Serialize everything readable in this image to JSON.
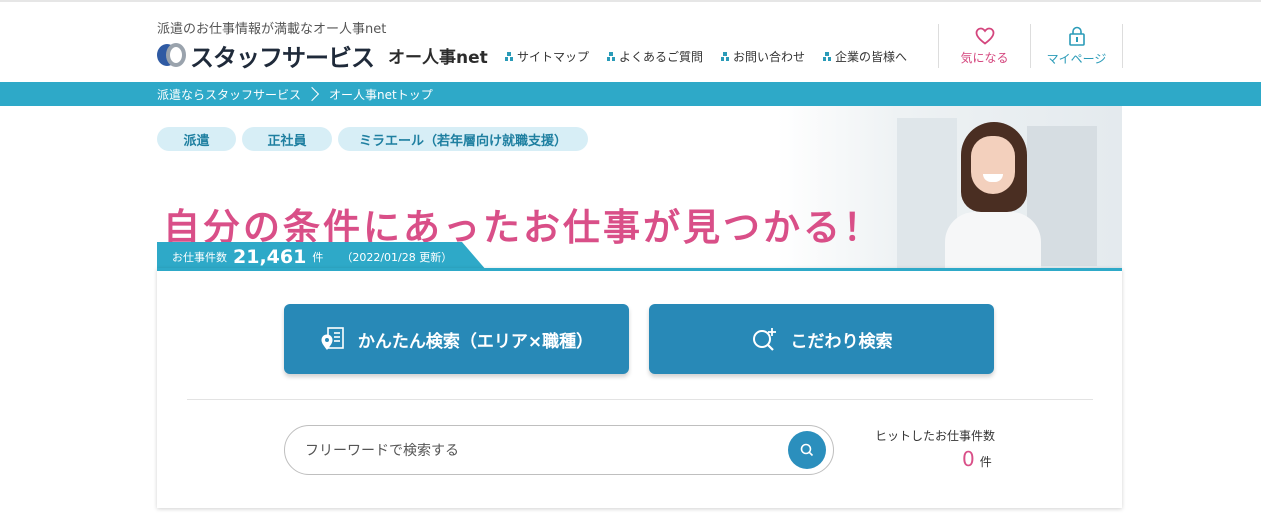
{
  "header": {
    "tagline": "派遣のお仕事情報が満載なオー人事net",
    "logo_text": "スタッフサービス",
    "logo_sub": "オー人事net",
    "nav": [
      {
        "label": "サイトマップ"
      },
      {
        "label": "よくあるご質問"
      },
      {
        "label": "お問い合わせ"
      },
      {
        "label": "企業の皆様へ"
      }
    ],
    "favorite_label": "気になる",
    "mypage_label": "マイページ"
  },
  "breadcrumb": {
    "items": [
      "派遣ならスタッフサービス",
      "オー人事netトップ"
    ]
  },
  "hero": {
    "categories": [
      "派遣",
      "正社員",
      "ミラエール（若年層向け就職支援）"
    ],
    "headline": "自分の条件にあったお仕事が見つかる！"
  },
  "job_count": {
    "label": "お仕事件数",
    "value": "21,461",
    "unit": "件",
    "date": "（2022/01/28 更新）"
  },
  "search": {
    "easy_label": "かんたん検索（エリア×職種）",
    "detail_label": "こだわり検索",
    "placeholder": "フリーワードで検索する",
    "hits_label": "ヒットしたお仕事件数",
    "hits_value": "0",
    "hits_unit": "件"
  },
  "colors": {
    "accent": "#2ea9c8",
    "button": "#2889b7",
    "pink": "#d94f88"
  }
}
